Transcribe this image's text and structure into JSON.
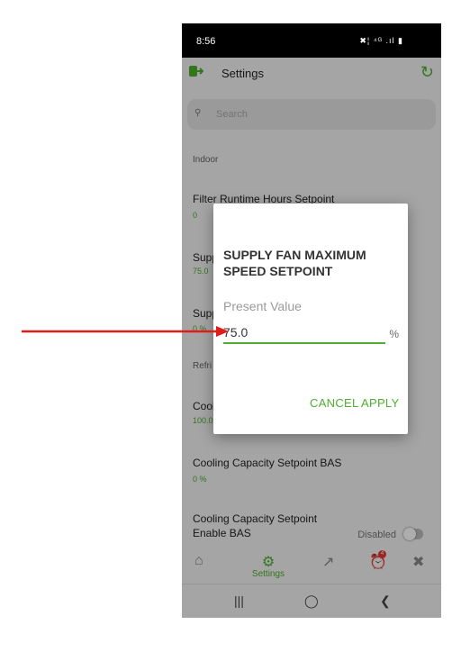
{
  "status_bar": {
    "time": "8:56",
    "right_icons": "✖¦ ⁴ᴳ .ıl ▮"
  },
  "app_bar": {
    "title": "Settings"
  },
  "search": {
    "placeholder": "Search"
  },
  "sections": [
    {
      "label": "Indoor"
    },
    {
      "label": "Refri"
    }
  ],
  "rows": [
    {
      "title": "Filter Runtime Hours Setpoint",
      "value": "0"
    },
    {
      "title": "Supp",
      "value": "75.0"
    },
    {
      "title": "Supp",
      "value": "0 %"
    },
    {
      "title": "Cool",
      "value": "100.0"
    },
    {
      "title": "Cooling Capacity Setpoint BAS",
      "value": "0 %"
    },
    {
      "title": "Cooling Capacity Setpoint Enable BAS",
      "value": ""
    }
  ],
  "toggle": {
    "label": "Disabled",
    "on": false
  },
  "bottom_nav": {
    "settings_label": "Settings",
    "alarm_count": "4"
  },
  "dialog": {
    "title": "SUPPLY FAN MAXIMUM SPEED SETPOINT",
    "field_label": "Present Value",
    "field_value": "75.0",
    "unit": "%",
    "cancel": "CANCEL",
    "apply": "APPLY"
  },
  "colors": {
    "accent": "#4caf2d",
    "annotation_arrow": "#e01b1b"
  }
}
